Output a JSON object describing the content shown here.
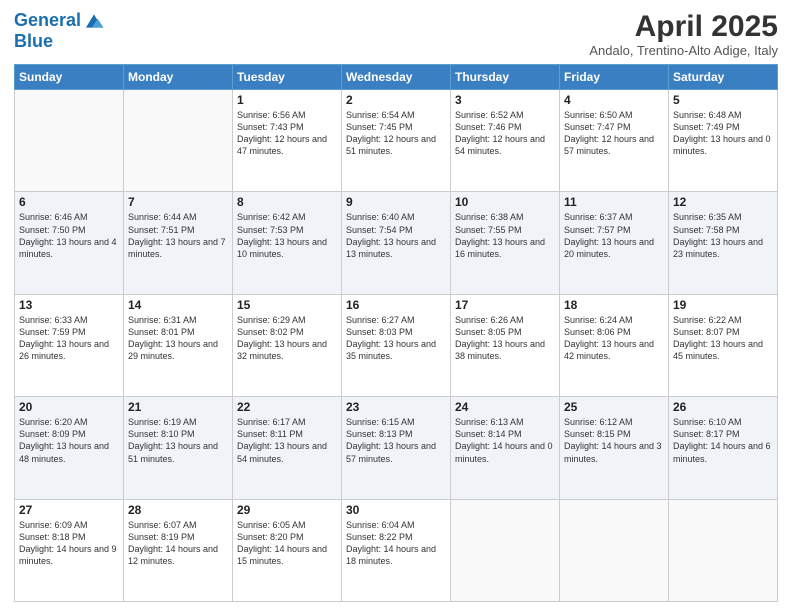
{
  "logo": {
    "line1": "General",
    "line2": "Blue"
  },
  "title": "April 2025",
  "location": "Andalo, Trentino-Alto Adige, Italy",
  "days_of_week": [
    "Sunday",
    "Monday",
    "Tuesday",
    "Wednesday",
    "Thursday",
    "Friday",
    "Saturday"
  ],
  "weeks": [
    [
      {
        "day": "",
        "info": ""
      },
      {
        "day": "",
        "info": ""
      },
      {
        "day": "1",
        "info": "Sunrise: 6:56 AM\nSunset: 7:43 PM\nDaylight: 12 hours and 47 minutes."
      },
      {
        "day": "2",
        "info": "Sunrise: 6:54 AM\nSunset: 7:45 PM\nDaylight: 12 hours and 51 minutes."
      },
      {
        "day": "3",
        "info": "Sunrise: 6:52 AM\nSunset: 7:46 PM\nDaylight: 12 hours and 54 minutes."
      },
      {
        "day": "4",
        "info": "Sunrise: 6:50 AM\nSunset: 7:47 PM\nDaylight: 12 hours and 57 minutes."
      },
      {
        "day": "5",
        "info": "Sunrise: 6:48 AM\nSunset: 7:49 PM\nDaylight: 13 hours and 0 minutes."
      }
    ],
    [
      {
        "day": "6",
        "info": "Sunrise: 6:46 AM\nSunset: 7:50 PM\nDaylight: 13 hours and 4 minutes."
      },
      {
        "day": "7",
        "info": "Sunrise: 6:44 AM\nSunset: 7:51 PM\nDaylight: 13 hours and 7 minutes."
      },
      {
        "day": "8",
        "info": "Sunrise: 6:42 AM\nSunset: 7:53 PM\nDaylight: 13 hours and 10 minutes."
      },
      {
        "day": "9",
        "info": "Sunrise: 6:40 AM\nSunset: 7:54 PM\nDaylight: 13 hours and 13 minutes."
      },
      {
        "day": "10",
        "info": "Sunrise: 6:38 AM\nSunset: 7:55 PM\nDaylight: 13 hours and 16 minutes."
      },
      {
        "day": "11",
        "info": "Sunrise: 6:37 AM\nSunset: 7:57 PM\nDaylight: 13 hours and 20 minutes."
      },
      {
        "day": "12",
        "info": "Sunrise: 6:35 AM\nSunset: 7:58 PM\nDaylight: 13 hours and 23 minutes."
      }
    ],
    [
      {
        "day": "13",
        "info": "Sunrise: 6:33 AM\nSunset: 7:59 PM\nDaylight: 13 hours and 26 minutes."
      },
      {
        "day": "14",
        "info": "Sunrise: 6:31 AM\nSunset: 8:01 PM\nDaylight: 13 hours and 29 minutes."
      },
      {
        "day": "15",
        "info": "Sunrise: 6:29 AM\nSunset: 8:02 PM\nDaylight: 13 hours and 32 minutes."
      },
      {
        "day": "16",
        "info": "Sunrise: 6:27 AM\nSunset: 8:03 PM\nDaylight: 13 hours and 35 minutes."
      },
      {
        "day": "17",
        "info": "Sunrise: 6:26 AM\nSunset: 8:05 PM\nDaylight: 13 hours and 38 minutes."
      },
      {
        "day": "18",
        "info": "Sunrise: 6:24 AM\nSunset: 8:06 PM\nDaylight: 13 hours and 42 minutes."
      },
      {
        "day": "19",
        "info": "Sunrise: 6:22 AM\nSunset: 8:07 PM\nDaylight: 13 hours and 45 minutes."
      }
    ],
    [
      {
        "day": "20",
        "info": "Sunrise: 6:20 AM\nSunset: 8:09 PM\nDaylight: 13 hours and 48 minutes."
      },
      {
        "day": "21",
        "info": "Sunrise: 6:19 AM\nSunset: 8:10 PM\nDaylight: 13 hours and 51 minutes."
      },
      {
        "day": "22",
        "info": "Sunrise: 6:17 AM\nSunset: 8:11 PM\nDaylight: 13 hours and 54 minutes."
      },
      {
        "day": "23",
        "info": "Sunrise: 6:15 AM\nSunset: 8:13 PM\nDaylight: 13 hours and 57 minutes."
      },
      {
        "day": "24",
        "info": "Sunrise: 6:13 AM\nSunset: 8:14 PM\nDaylight: 14 hours and 0 minutes."
      },
      {
        "day": "25",
        "info": "Sunrise: 6:12 AM\nSunset: 8:15 PM\nDaylight: 14 hours and 3 minutes."
      },
      {
        "day": "26",
        "info": "Sunrise: 6:10 AM\nSunset: 8:17 PM\nDaylight: 14 hours and 6 minutes."
      }
    ],
    [
      {
        "day": "27",
        "info": "Sunrise: 6:09 AM\nSunset: 8:18 PM\nDaylight: 14 hours and 9 minutes."
      },
      {
        "day": "28",
        "info": "Sunrise: 6:07 AM\nSunset: 8:19 PM\nDaylight: 14 hours and 12 minutes."
      },
      {
        "day": "29",
        "info": "Sunrise: 6:05 AM\nSunset: 8:20 PM\nDaylight: 14 hours and 15 minutes."
      },
      {
        "day": "30",
        "info": "Sunrise: 6:04 AM\nSunset: 8:22 PM\nDaylight: 14 hours and 18 minutes."
      },
      {
        "day": "",
        "info": ""
      },
      {
        "day": "",
        "info": ""
      },
      {
        "day": "",
        "info": ""
      }
    ]
  ]
}
